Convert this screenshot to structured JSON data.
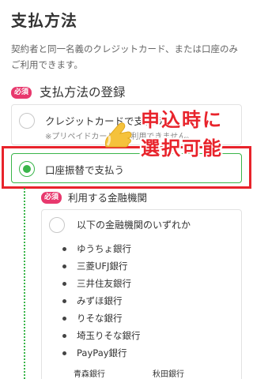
{
  "page": {
    "title": "支払方法",
    "description": "契約者と同一名義のクレジットカード、または口座のみご利用できます。"
  },
  "section": {
    "required_badge": "必須",
    "title": "支払方法の登録"
  },
  "options": {
    "credit": {
      "label": "クレジットカードで支払う",
      "note": "※プリペイドカードはご利用できません。"
    },
    "bank": {
      "label": "口座振替で支払う",
      "selected": true
    }
  },
  "callout": {
    "line1": "申込時に",
    "line2": "選択可能"
  },
  "institution": {
    "required_badge": "必須",
    "title": "利用する金融機関",
    "header": "以下の金融機関のいずれか",
    "banks": [
      "ゆうちょ銀行",
      "三菱UFJ銀行",
      "三井住友銀行",
      "みずほ銀行",
      "りそな銀行",
      "埼玉りそな銀行",
      "PayPay銀行"
    ],
    "more_banks": [
      "青森銀行",
      "秋田銀行"
    ]
  },
  "colors": {
    "accent_green": "#3ab54a",
    "badge_pink": "#e8386d",
    "highlight_red": "#e8232b"
  },
  "icons": {
    "pointer": "pointing-finger-icon"
  }
}
